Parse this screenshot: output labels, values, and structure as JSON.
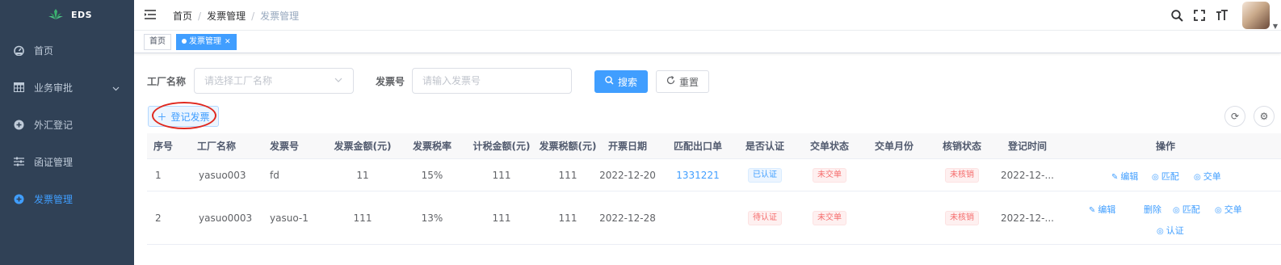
{
  "app": {
    "logo_text": "EDS"
  },
  "sidebar": {
    "items": [
      {
        "label": "首页",
        "icon": "dashboard-icon"
      },
      {
        "label": "业务审批",
        "icon": "table-icon"
      },
      {
        "label": "外汇登记",
        "icon": "plus-circle-icon"
      },
      {
        "label": "函证管理",
        "icon": "sliders-icon"
      },
      {
        "label": "发票管理",
        "icon": "plus-circle-icon"
      }
    ]
  },
  "breadcrumb": [
    "首页",
    "发票管理",
    "发票管理"
  ],
  "tags": [
    {
      "label": "首页"
    },
    {
      "label": "发票管理"
    }
  ],
  "search": {
    "factory_label": "工厂名称",
    "factory_placeholder": "请选择工厂名称",
    "invoice_label": "发票号",
    "invoice_placeholder": "请输入发票号",
    "search_button": "搜索",
    "reset_button": "重置"
  },
  "toolbar": {
    "register_button": "登记发票"
  },
  "table": {
    "headers": [
      "序号",
      "工厂名称",
      "发票号",
      "发票金额(元)",
      "发票税率",
      "计税金额(元)",
      "发票税额(元)",
      "开票日期",
      "匹配出口单",
      "是否认证",
      "交单状态",
      "交单月份",
      "核销状态",
      "登记时间",
      "操作"
    ],
    "rows": [
      {
        "index": "1",
        "factory": "yasuo003",
        "invoice_no": "fd",
        "amount": "11",
        "tax_rate": "15%",
        "taxable": "111",
        "tax": "111",
        "date": "2022-12-20",
        "export_no": "1331221",
        "certified": "已认证",
        "submit_status": "未交单",
        "submit_month": "",
        "writeoff": "未核销",
        "reg_time": "2022-12-...",
        "ops": [
          "编辑",
          "匹配",
          "交单"
        ]
      },
      {
        "index": "2",
        "factory": "yasuo0003",
        "invoice_no": "yasuo-1",
        "amount": "111",
        "tax_rate": "13%",
        "taxable": "111",
        "tax": "111",
        "date": "2022-12-28",
        "export_no": "",
        "certified": "待认证",
        "submit_status": "未交单",
        "submit_month": "",
        "writeoff": "未核销",
        "reg_time": "2022-12-...",
        "ops": [
          "编辑",
          "删除",
          "匹配",
          "交单",
          "认证"
        ]
      }
    ]
  },
  "colors": {
    "sidebar_bg": "#304156",
    "primary": "#409eff",
    "danger": "#f56c6c",
    "annotation": "#e0281e"
  }
}
